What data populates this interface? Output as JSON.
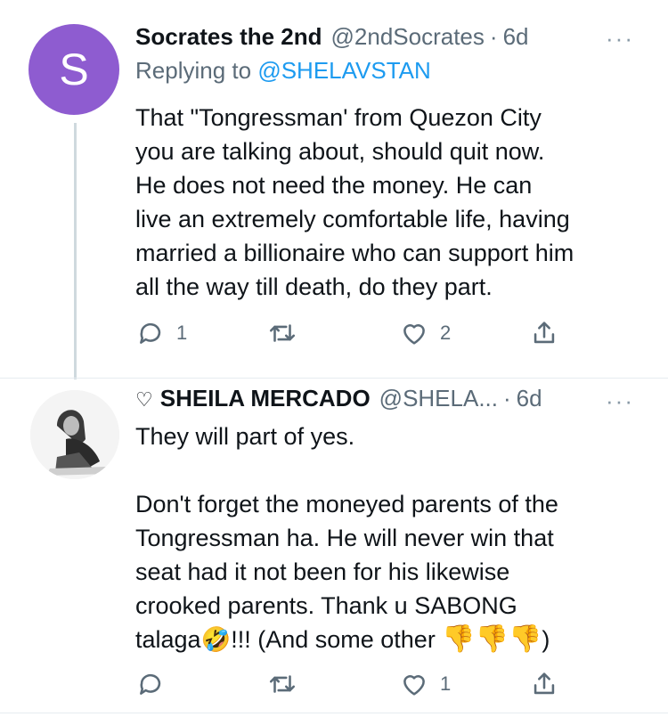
{
  "tweet1": {
    "avatar_letter": "S",
    "name": "Socrates the 2nd",
    "handle": "@2ndSocrates",
    "time": "6d",
    "reply_prefix": "Replying to ",
    "reply_handle": "@SHELAVSTAN",
    "lines": [
      "That \"Tongressman' from Quezon City",
      "you are talking about, should quit now.",
      "He does not need the money.  He can",
      "live an extremely comfortable life, having",
      "married a billionaire who can support him",
      "all the way till death, do they part."
    ],
    "reply_count": "1",
    "retweet_count": "",
    "like_count": "2"
  },
  "tweet2": {
    "heart_prefix": "♡",
    "name": "SHEILA MERCADO",
    "handle": "@SHELA...",
    "time": "6d",
    "lines": [
      "They will part of yes.",
      "",
      "Don't forget the moneyed parents of the",
      "Tongressman ha. He will never win that",
      "seat had it not been for his likewise",
      "crooked parents. Thank u SABONG"
    ],
    "last_line_a": "talaga",
    "emoji_laugh": "🤣",
    "last_line_b": "!!! (And some other ",
    "thumbs": "👎👎👎",
    "last_line_c": ")",
    "reply_count": "",
    "retweet_count": "",
    "like_count": "1"
  },
  "more_glyph": "···",
  "dot_sep": "·",
  "colors": {
    "accent": "#1d9bf0",
    "avatar_bg": "#8e5cd0",
    "muted": "#5b6b78"
  }
}
